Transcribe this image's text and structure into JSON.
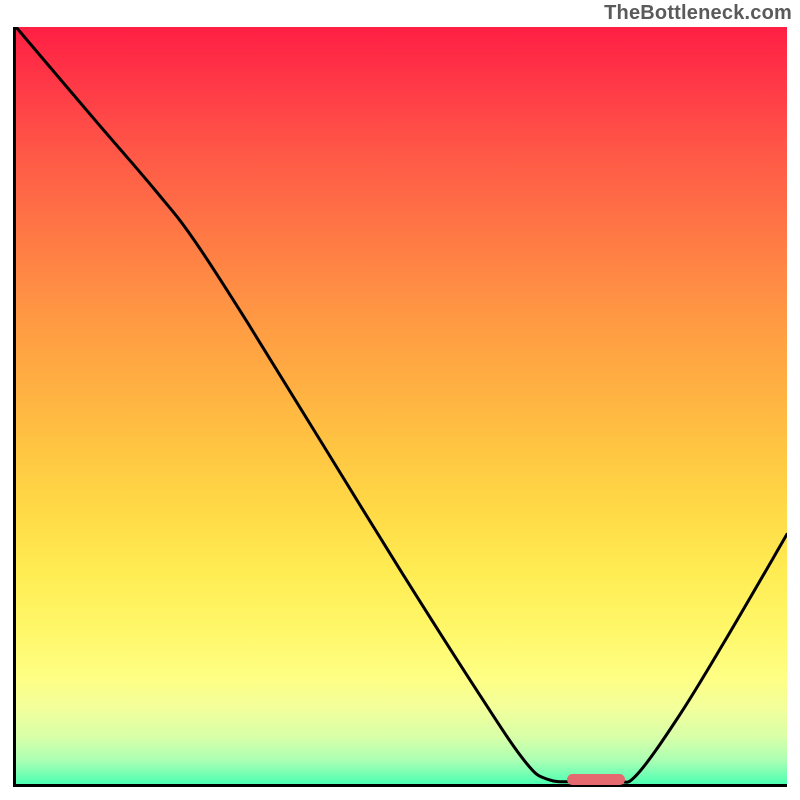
{
  "watermark": "TheBottleneck.com",
  "chart_data": {
    "type": "line",
    "title": "",
    "xlabel": "",
    "ylabel": "",
    "x_range": [
      0,
      100
    ],
    "y_range": [
      0,
      100
    ],
    "curve_points": [
      {
        "x": 0.0,
        "y": 100.0
      },
      {
        "x": 10.0,
        "y": 88.0
      },
      {
        "x": 18.0,
        "y": 78.5
      },
      {
        "x": 23.0,
        "y": 72.0
      },
      {
        "x": 30.0,
        "y": 61.0
      },
      {
        "x": 40.0,
        "y": 44.5
      },
      {
        "x": 50.0,
        "y": 28.0
      },
      {
        "x": 60.0,
        "y": 12.0
      },
      {
        "x": 66.0,
        "y": 3.0
      },
      {
        "x": 69.0,
        "y": 0.6
      },
      {
        "x": 73.0,
        "y": 0.3
      },
      {
        "x": 78.0,
        "y": 0.3
      },
      {
        "x": 80.5,
        "y": 1.2
      },
      {
        "x": 86.0,
        "y": 9.0
      },
      {
        "x": 92.0,
        "y": 19.0
      },
      {
        "x": 100.0,
        "y": 33.0
      }
    ],
    "marker": {
      "x_start": 71.5,
      "x_end": 79.0,
      "y": 0.6
    },
    "gradient_colors": {
      "top": "#ff1f44",
      "mid": "#ffda46",
      "bottom": "#4dffb2"
    }
  }
}
